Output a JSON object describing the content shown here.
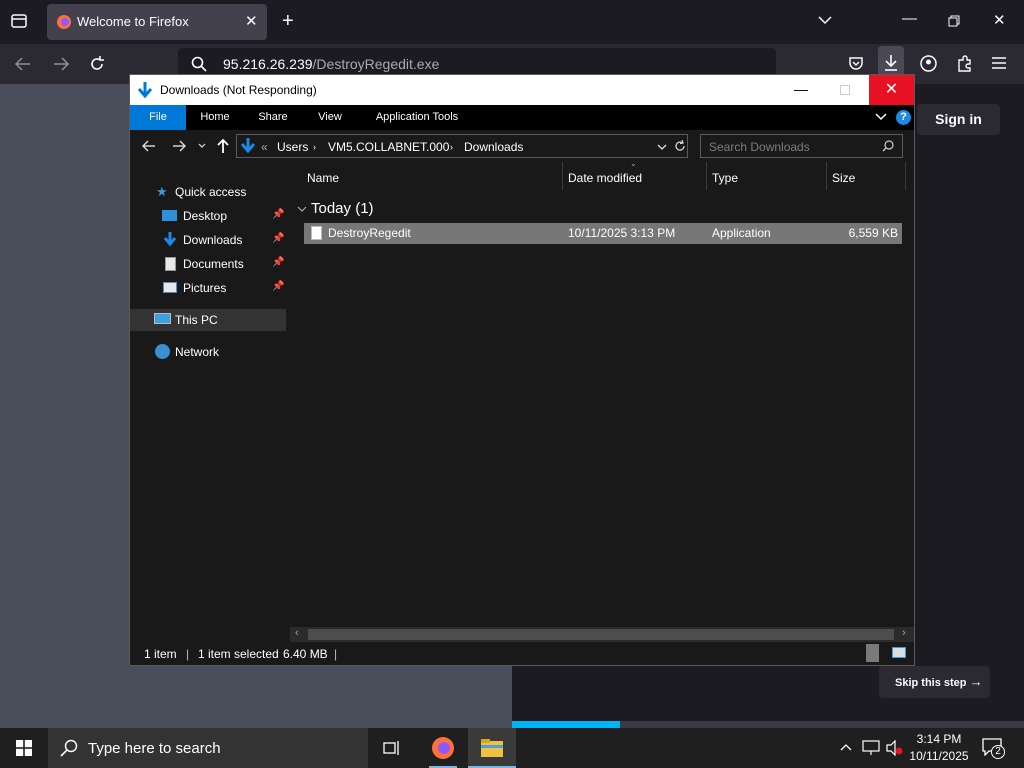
{
  "browser": {
    "tab_title": "Welcome to Firefox",
    "url_host": "95.216.26.239",
    "url_path": "/DestroyRegedit.exe",
    "sign_in": "Sign in",
    "skip_step": "Skip this step",
    "progress_fraction": 0.21
  },
  "explorer": {
    "title": "Downloads (Not Responding)",
    "ribbon_tabs": [
      "File",
      "Home",
      "Share",
      "View",
      "Application Tools"
    ],
    "breadcrumb": [
      "Users",
      "VM5.COLLABNET.000",
      "Downloads"
    ],
    "breadcrumb_overflow": "«",
    "search_placeholder": "Search Downloads",
    "nav": {
      "quick_access": "Quick access",
      "desktop": "Desktop",
      "downloads": "Downloads",
      "documents": "Documents",
      "pictures": "Pictures",
      "this_pc": "This PC",
      "network": "Network"
    },
    "columns": {
      "name": "Name",
      "date": "Date modified",
      "type": "Type",
      "size": "Size"
    },
    "group_header": "Today (1)",
    "file": {
      "name": "DestroyRegedit",
      "date": "10/11/2025 3:13 PM",
      "type": "Application",
      "size": "6,559 KB"
    },
    "status": {
      "count": "1 item",
      "selected": "1 item selected",
      "size": "6.40 MB"
    }
  },
  "taskbar": {
    "search_placeholder": "Type here to search",
    "time": "3:14 PM",
    "date": "10/11/2025",
    "notification_count": "2"
  },
  "colors": {
    "accent_blue": "#0078d7",
    "close_red": "#e81123",
    "progress_cyan": "#00b3f4"
  }
}
